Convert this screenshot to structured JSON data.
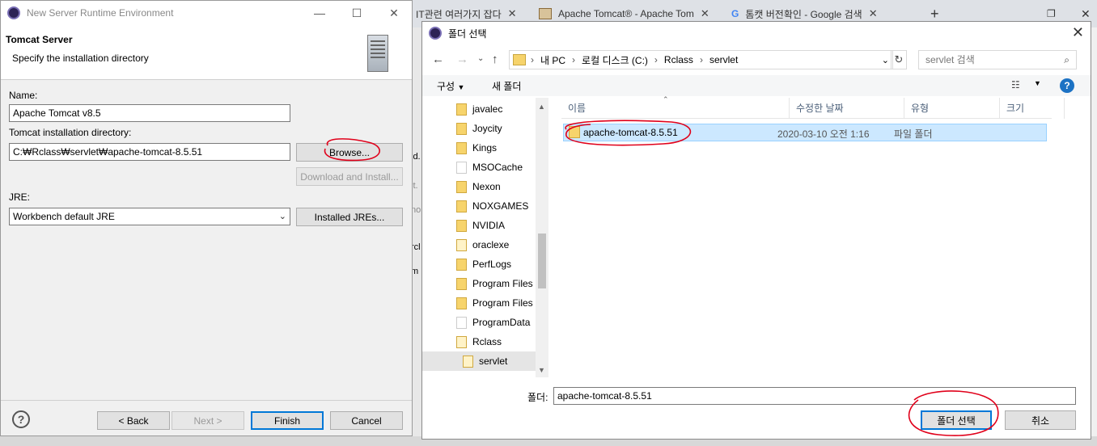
{
  "browser": {
    "tabs": [
      {
        "label": "IT관련 여러가지 잡다"
      },
      {
        "label": "Apache Tomcat® - Apache Tom"
      },
      {
        "label": "톰캣 버전확인 - Google 검색"
      }
    ],
    "partial_labels": [
      "ld.",
      "it.",
      "no",
      "rcl",
      "m"
    ]
  },
  "eclipse_dialog": {
    "title": "New Server Runtime Environment",
    "header_title": "Tomcat Server",
    "header_subtitle": "Specify the installation directory",
    "name_label": "Name:",
    "name_value": "Apache Tomcat v8.5",
    "dir_label": "Tomcat installation directory:",
    "dir_value": "C:₩Rclass₩servlet₩apache-tomcat-8.5.51",
    "browse_label": "Browse...",
    "download_label": "Download and Install...",
    "jre_label": "JRE:",
    "jre_value": "Workbench default JRE",
    "installed_jres_label": "Installed JREs...",
    "back_label": "< Back",
    "next_label": "Next >",
    "finish_label": "Finish",
    "cancel_label": "Cancel",
    "help_glyph": "?"
  },
  "folder_picker": {
    "title": "폴더 선택",
    "breadcrumb": [
      "내 PC",
      "로컬 디스크 (C:)",
      "Rclass",
      "servlet"
    ],
    "search_placeholder": "servlet 검색",
    "organize_label": "구성",
    "new_folder_label": "새 폴더",
    "tree_items": [
      {
        "label": "javalec"
      },
      {
        "label": "Joycity"
      },
      {
        "label": "Kings"
      },
      {
        "label": "MSOCache"
      },
      {
        "label": "Nexon"
      },
      {
        "label": "NOXGAMES"
      },
      {
        "label": "NVIDIA"
      },
      {
        "label": "oraclexe"
      },
      {
        "label": "PerfLogs"
      },
      {
        "label": "Program Files"
      },
      {
        "label": "Program Files"
      },
      {
        "label": "ProgramData"
      },
      {
        "label": "Rclass"
      },
      {
        "label": "servlet"
      }
    ],
    "columns": {
      "name": "이름",
      "modified": "수정한 날짜",
      "type": "유형",
      "size": "크기"
    },
    "rows": [
      {
        "name": "apache-tomcat-8.5.51",
        "modified": "2020-03-10 오전 1:16",
        "type": "파일 폴더",
        "size": ""
      }
    ],
    "folder_label": "폴더:",
    "folder_value": "apache-tomcat-8.5.51",
    "select_label": "폴더 선택",
    "cancel_label": "취소"
  },
  "colors": {
    "annotation": "#e0001a",
    "selection": "#cce8ff",
    "accent": "#0078d7"
  }
}
